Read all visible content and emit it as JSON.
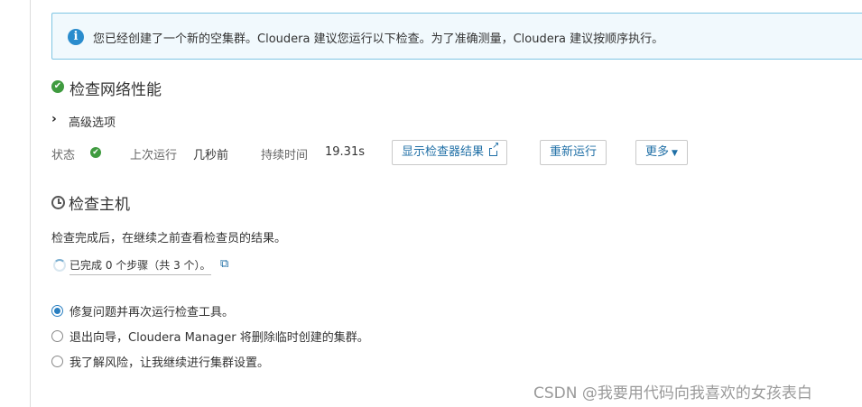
{
  "alert": {
    "icon": "info-icon",
    "message": "您已经创建了一个新的空集群。Cloudera 建议您运行以下检查。为了准确测量，Cloudera 建议按顺序执行。"
  },
  "network_check": {
    "title": "检查网络性能",
    "advanced_label": "高级选项",
    "status_label": "状态",
    "last_run_label": "上次运行",
    "last_run_value": "几秒前",
    "duration_label": "持续时间",
    "duration_value": "19.31s",
    "show_results_button": "显示检查器结果",
    "rerun_button": "重新运行",
    "more_button": "更多"
  },
  "host_check": {
    "title": "检查主机",
    "description": "检查完成后，在继续之前查看检查员的结果。",
    "progress_text": "已完成 0 个步骤（共 3 个）。"
  },
  "options": [
    {
      "label": "修复问题并再次运行检查工具。",
      "checked": true
    },
    {
      "label": "退出向导，Cloudera Manager 将删除临时创建的集群。",
      "checked": false
    },
    {
      "label": "我了解风险，让我继续进行集群设置。",
      "checked": false
    }
  ],
  "watermark": "CSDN @我要用代码向我喜欢的女孩表白",
  "colors": {
    "accent": "#1f6fa6",
    "success": "#3f9b3f",
    "alert_bg": "#f1f9fd",
    "alert_border": "#7fc5e3"
  }
}
